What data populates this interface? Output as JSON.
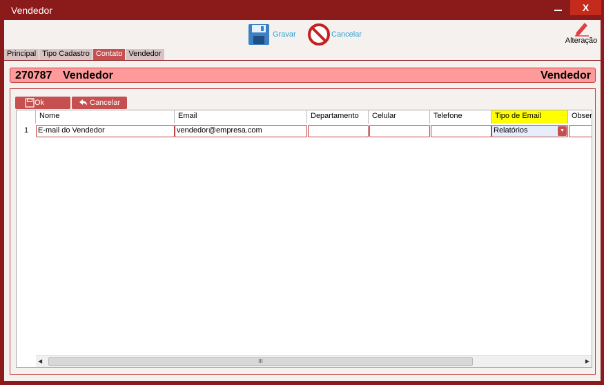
{
  "window": {
    "title": "Vendedor",
    "close_label": "X"
  },
  "toolbar": {
    "gravar_label": "Gravar",
    "cancelar_label": "Cancelar",
    "alteracao_label": "Alteração"
  },
  "tabs": [
    {
      "label": "Principal",
      "active": false
    },
    {
      "label": "Tipo Cadastro",
      "active": false
    },
    {
      "label": "Contato",
      "active": true
    },
    {
      "label": "Vendedor",
      "active": false
    }
  ],
  "header": {
    "code": "270787",
    "name": "Vendedor",
    "right_label": "Vendedor"
  },
  "actions": {
    "ok_label": "Ok",
    "cancel_label": "Cancelar"
  },
  "grid": {
    "columns": [
      "Nome",
      "Email",
      "Departamento",
      "Celular",
      "Telefone",
      "Tipo de Email",
      "Obser"
    ],
    "rows": [
      {
        "num": "1",
        "nome": "E-mail do Vendedor",
        "email": "vendedor@empresa.com",
        "departamento": "",
        "celular": "",
        "telefone": "",
        "tipo_email": "Relatórios",
        "observacao": ""
      }
    ],
    "scroll_thumb_label": "III"
  },
  "colors": {
    "accent": "#8b1a1a",
    "highlight": "#ff9a9a",
    "button": "#c65050",
    "active_column": "#ffff00"
  }
}
